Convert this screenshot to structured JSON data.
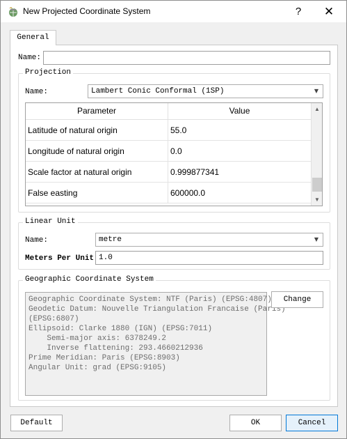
{
  "window": {
    "title": "New Projected Coordinate System",
    "help_label": "?",
    "close_label": "✕",
    "icon": "globe-app-icon"
  },
  "tabs": [
    {
      "label": "General",
      "selected": true
    }
  ],
  "general": {
    "name_label": "Name:",
    "name_value": ""
  },
  "projection": {
    "group_title": "Projection",
    "name_label": "Name:",
    "name_value": "Lambert Conic Conformal (1SP)",
    "table": {
      "headers": [
        "Parameter",
        "Value"
      ],
      "rows": [
        {
          "parameter": "Latitude of natural origin",
          "value": "55.0"
        },
        {
          "parameter": "Longitude of natural origin",
          "value": "0.0"
        },
        {
          "parameter": "Scale factor at natural origin",
          "value": "0.999877341"
        },
        {
          "parameter": "False easting",
          "value": "600000.0"
        }
      ]
    }
  },
  "linear_unit": {
    "group_title": "Linear Unit",
    "name_label": "Name:",
    "name_value": "metre",
    "meters_label": "Meters Per Unit:",
    "meters_value": "1.0"
  },
  "gcs": {
    "group_title": "Geographic Coordinate System",
    "lines": [
      "Geographic Coordinate System: NTF (Paris) (EPSG:4807)",
      "Geodetic Datum: Nouvelle Triangulation Francaise (Paris)",
      "(EPSG:6807)",
      "Ellipsoid: Clarke 1880 (IGN) (EPSG:7011)",
      "    Semi-major axis: 6378249.2",
      "    Inverse flattening: 293.4660212936",
      "Prime Meridian: Paris (EPSG:8903)",
      "Angular Unit: grad (EPSG:9105)"
    ],
    "change_label": "Change"
  },
  "footer": {
    "default_label": "Default",
    "ok_label": "OK",
    "cancel_label": "Cancel"
  },
  "colors": {
    "accent": "#0078d7",
    "background": "#f0f0f0"
  }
}
